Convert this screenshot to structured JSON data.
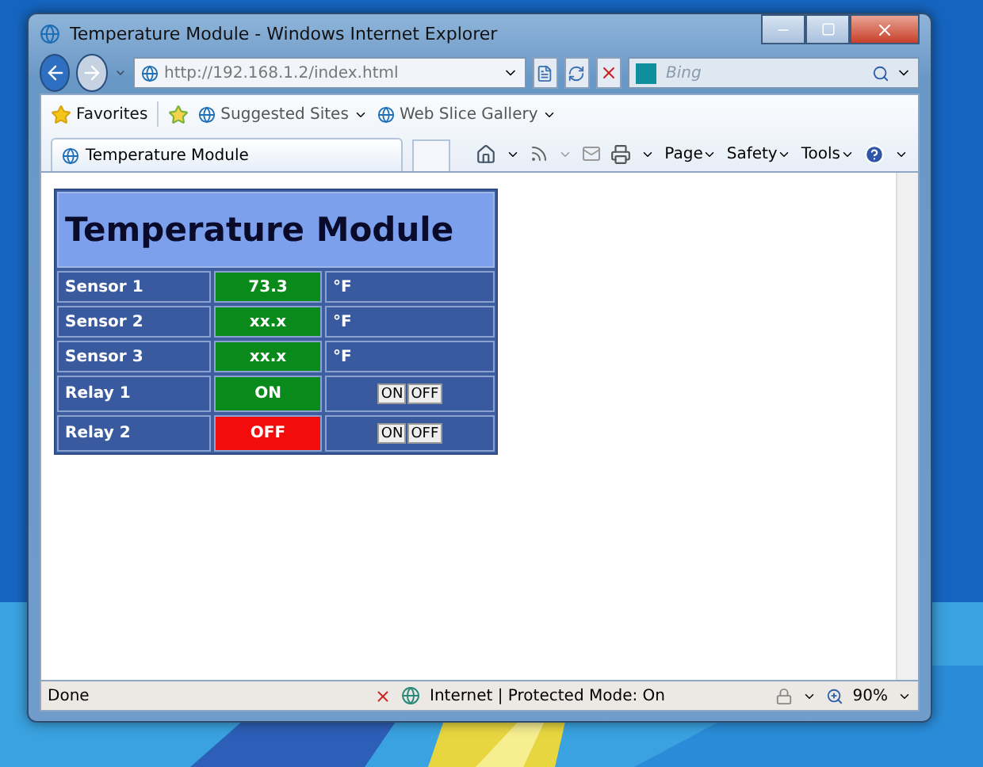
{
  "window": {
    "title": "Temperature Module - Windows Internet Explorer"
  },
  "address_bar": {
    "value": "http://192.168.1.2/index.html"
  },
  "search": {
    "placeholder": "Bing"
  },
  "favorites_bar": {
    "items": [
      "Favorites",
      "Suggested Sites",
      "Web Slice Gallery"
    ]
  },
  "tabs": [
    {
      "title": "Temperature Module",
      "selected": true
    }
  ],
  "command_bar": [
    "Page",
    "Safety",
    "Tools"
  ],
  "page": {
    "heading": "Temperature Module",
    "rows": [
      {
        "kind": "sensor",
        "label": "Sensor 1",
        "value": "73.3",
        "unit": "°F"
      },
      {
        "kind": "sensor",
        "label": "Sensor 2",
        "value": "xx.x",
        "unit": "°F"
      },
      {
        "kind": "sensor",
        "label": "Sensor 3",
        "value": "xx.x",
        "unit": "°F"
      },
      {
        "kind": "relay",
        "label": "Relay 1",
        "value": "ON",
        "on": true,
        "buttons": [
          "ON",
          "OFF"
        ]
      },
      {
        "kind": "relay",
        "label": "Relay 2",
        "value": "OFF",
        "on": false,
        "buttons": [
          "ON",
          "OFF"
        ]
      }
    ]
  },
  "status_bar": {
    "text": "Done",
    "zone": "Internet | Protected Mode: On",
    "zoom": "90%"
  }
}
